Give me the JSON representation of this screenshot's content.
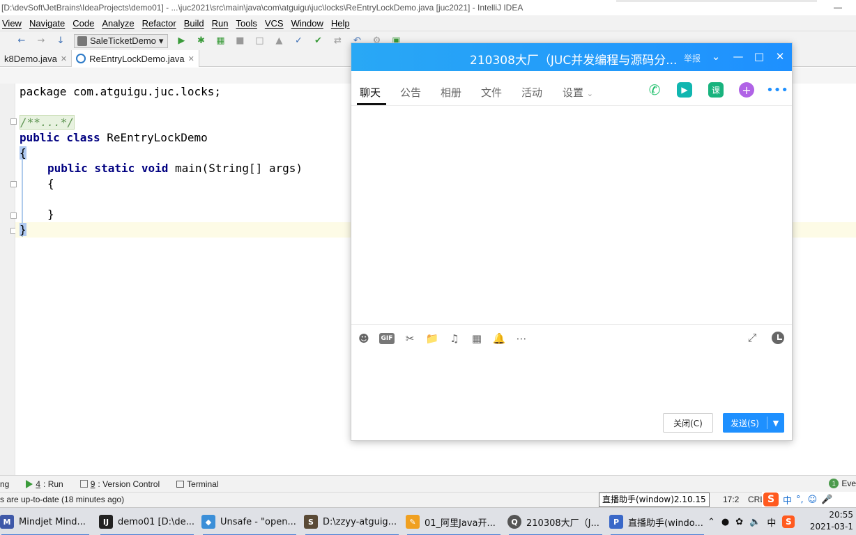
{
  "ide": {
    "title": "[D:\\devSoft\\JetBrains\\IdeaProjects\\demo01] - ...\\juc2021\\src\\main\\java\\com\\atguigu\\juc\\locks\\ReEntryLockDemo.java [juc2021] - IntelliJ IDEA",
    "menu": [
      "View",
      "Navigate",
      "Code",
      "Analyze",
      "Refactor",
      "Build",
      "Run",
      "Tools",
      "VCS",
      "Window",
      "Help"
    ],
    "run_config": "SaleTicketDemo",
    "tabs": [
      {
        "label": "k8Demo.java",
        "active": false
      },
      {
        "label": "ReEntryLockDemo.java",
        "active": true
      }
    ],
    "code": {
      "line1": "package com.atguigu.juc.locks;",
      "doc_collapsed": "/**...*/",
      "class_decl_kw": "public class",
      "class_name": " ReEntryLockDemo",
      "open_brace": "{",
      "method_kw": "public static void",
      "method_rest": " main(String[] args)",
      "method_open": "{",
      "method_close": "}",
      "close_brace": "}"
    },
    "tool_windows": [
      {
        "label": "ng"
      },
      {
        "key": "4",
        "label": ": Run"
      },
      {
        "key": "9",
        "label": ": Version Control"
      },
      {
        "label": "Terminal"
      }
    ],
    "event_log_label": "Eve",
    "event_log_count": "1",
    "status_message": "s are up-to-date (18 minutes ago)",
    "tooltip": "直播助手(window)2.10.15",
    "caret_position": "17:2",
    "line_separator": "CRL"
  },
  "qq_chat": {
    "title": "210308大厂（JUC并发编程与源码分...",
    "report_label": "举报",
    "tabs": [
      "聊天",
      "公告",
      "相册",
      "文件",
      "活动",
      "设置"
    ],
    "active_tab": "聊天",
    "header_icons": [
      "phone-icon",
      "video-call-icon",
      "course-icon",
      "add-app-icon",
      "more-icon"
    ],
    "course_icon_text": "课",
    "input_toolbar_icons": [
      "emoji-icon",
      "gif-icon",
      "screenshot-icon",
      "folder-icon",
      "music-icon",
      "image-icon",
      "bell-icon",
      "more-icon"
    ],
    "gif_label": "GIF",
    "close_button": "关闭(C)",
    "send_button": "发送(S)"
  },
  "taskbar": {
    "items": [
      {
        "label": "Mindjet Mind..."
      },
      {
        "label": "demo01 [D:\\de..."
      },
      {
        "label": "Unsafe - \"open..."
      },
      {
        "label": "D:\\zzyy-atguig..."
      },
      {
        "label": "01_阿里Java开..."
      },
      {
        "label": "210308大厂（J..."
      },
      {
        "label": "直播助手(windo..."
      }
    ],
    "tray": {
      "ime_language": "中",
      "ime_punct": "°,",
      "lang_indicator": "中"
    },
    "clock_time": "20:55",
    "clock_date": "2021-03-1"
  },
  "colors": {
    "qq_blue": "#1e90ff",
    "java_keyword": "#000080",
    "doc_green": "#629755"
  }
}
